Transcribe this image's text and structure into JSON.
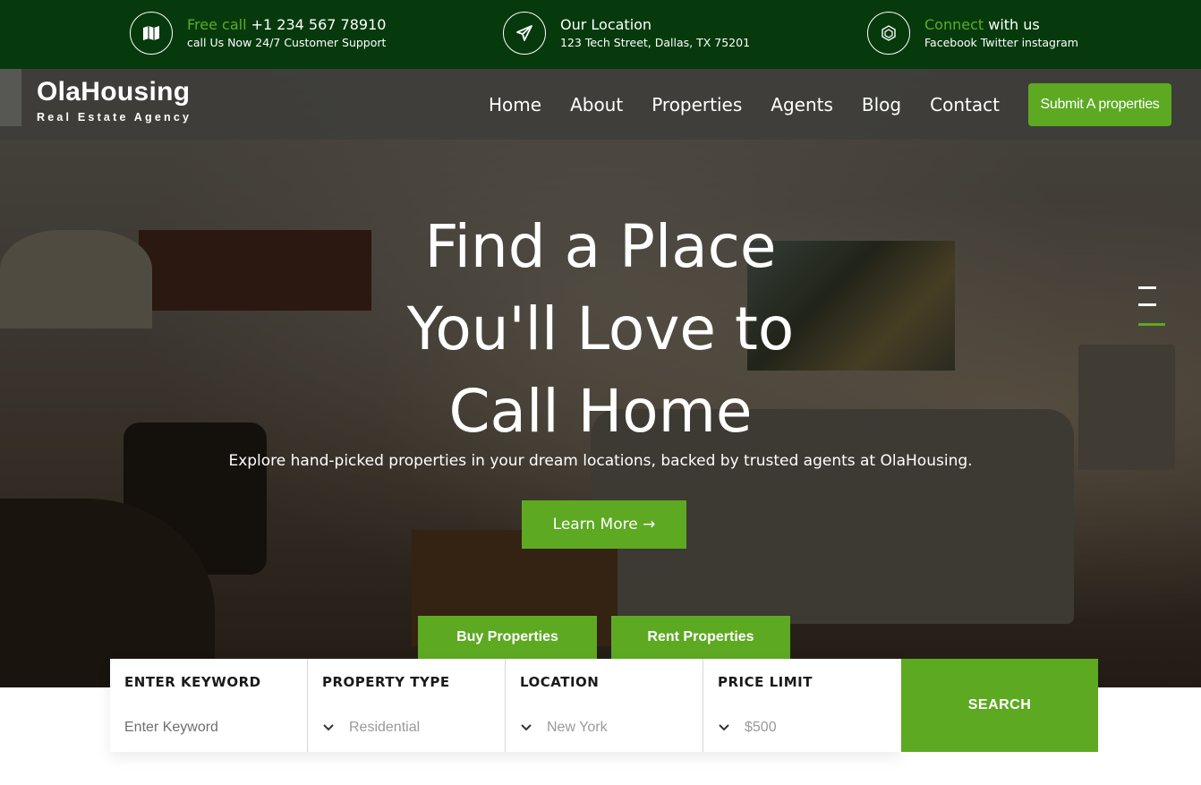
{
  "topbar": {
    "call": {
      "icon": "map-icon",
      "accent": "Free call",
      "number": "+1 234 567 78910",
      "sub": "call Us Now 24/7 Customer Support"
    },
    "location": {
      "icon": "paper-plane-icon",
      "title": "Our Location",
      "address": "123 Tech Street, Dallas, TX 75201"
    },
    "connect": {
      "icon": "network-icon",
      "accent": "Connect",
      "rest": "with us",
      "sub": "Facebook Twitter instagram"
    }
  },
  "brand": {
    "name": "OlaHousing",
    "tagline": "Real Estate Agency"
  },
  "nav": {
    "items": [
      "Home",
      "About",
      "Properties",
      "Agents",
      "Blog",
      "Contact"
    ],
    "cta": "Submit A properties"
  },
  "hero": {
    "title_lines": [
      "Find a Place",
      "You'll Love to",
      "Call Home"
    ],
    "subtitle": "Explore hand-picked properties in your dream locations, backed by trusted agents at OlaHousing.",
    "button": "Learn More →"
  },
  "tabs": [
    "Buy Properties",
    "Rent Properties"
  ],
  "search": {
    "fields": [
      {
        "label": "ENTER KEYWORD",
        "value": "Enter Keyword",
        "type": "input"
      },
      {
        "label": "PROPERTY TYPE",
        "value": "Residential",
        "type": "select"
      },
      {
        "label": "LOCATION",
        "value": "New York",
        "type": "select"
      },
      {
        "label": "PRICE LIMIT",
        "value": "$500",
        "type": "select"
      }
    ],
    "button": "SEARCH"
  },
  "colors": {
    "topbar": "#063a0c",
    "accent": "#5da922",
    "accent_text": "#5faa2a"
  }
}
